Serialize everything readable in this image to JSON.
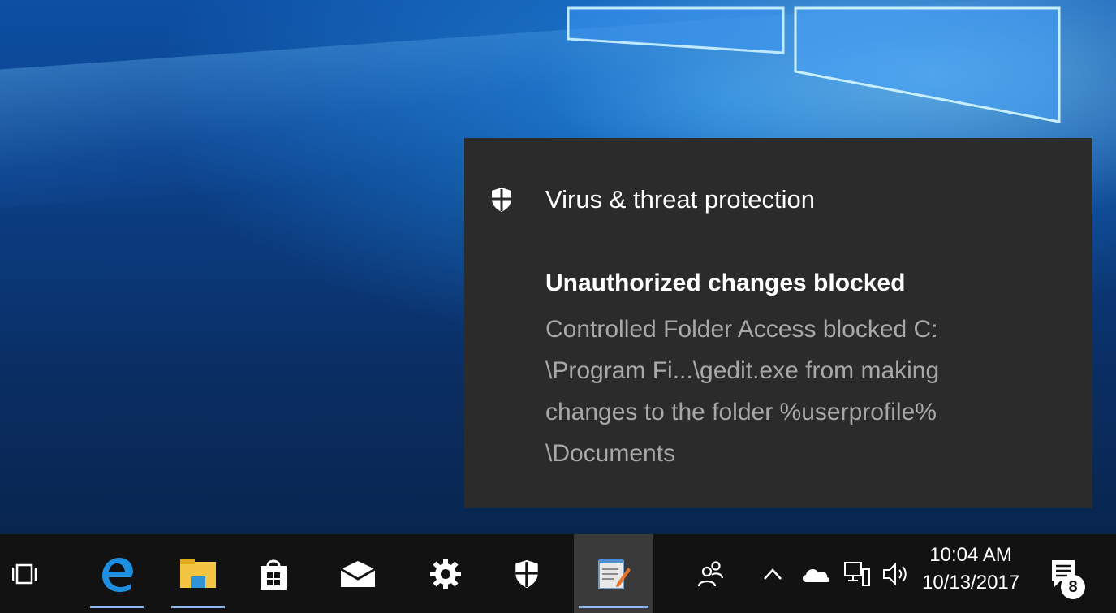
{
  "notification": {
    "app_name": "Virus & threat protection",
    "title": "Unauthorized changes blocked",
    "body": "Controlled Folder Access blocked C:\n\\Program Fi...\\gedit.exe from making\nchanges to the folder %userprofile%\n\\Documents",
    "icon": "shield-icon"
  },
  "taskbar": {
    "items": [
      {
        "name": "task-view",
        "icon": "task-view-icon"
      },
      {
        "name": "edge",
        "icon": "edge-icon"
      },
      {
        "name": "file-explorer",
        "icon": "folder-icon"
      },
      {
        "name": "store",
        "icon": "store-bag-icon"
      },
      {
        "name": "mail",
        "icon": "mail-icon"
      },
      {
        "name": "settings",
        "icon": "gear-icon"
      },
      {
        "name": "windows-defender",
        "icon": "shield-icon"
      },
      {
        "name": "notepad",
        "icon": "notepad-icon"
      }
    ],
    "tray": {
      "people_icon": "people-icon",
      "chevron_icon": "chevron-up-icon",
      "cloud_icon": "onedrive-cloud-icon",
      "network_icon": "network-icon",
      "volume_icon": "volume-icon"
    },
    "clock": {
      "time": "10:04 AM",
      "date": "10/13/2017"
    },
    "action_center": {
      "icon": "action-center-icon",
      "badge": "8"
    }
  },
  "colors": {
    "toast_bg": "#2b2b2b",
    "taskbar_bg": "#121212",
    "edge_blue": "#1e8fe0",
    "folder_yellow": "#f4c542",
    "active_underline": "#8fb9e8"
  }
}
